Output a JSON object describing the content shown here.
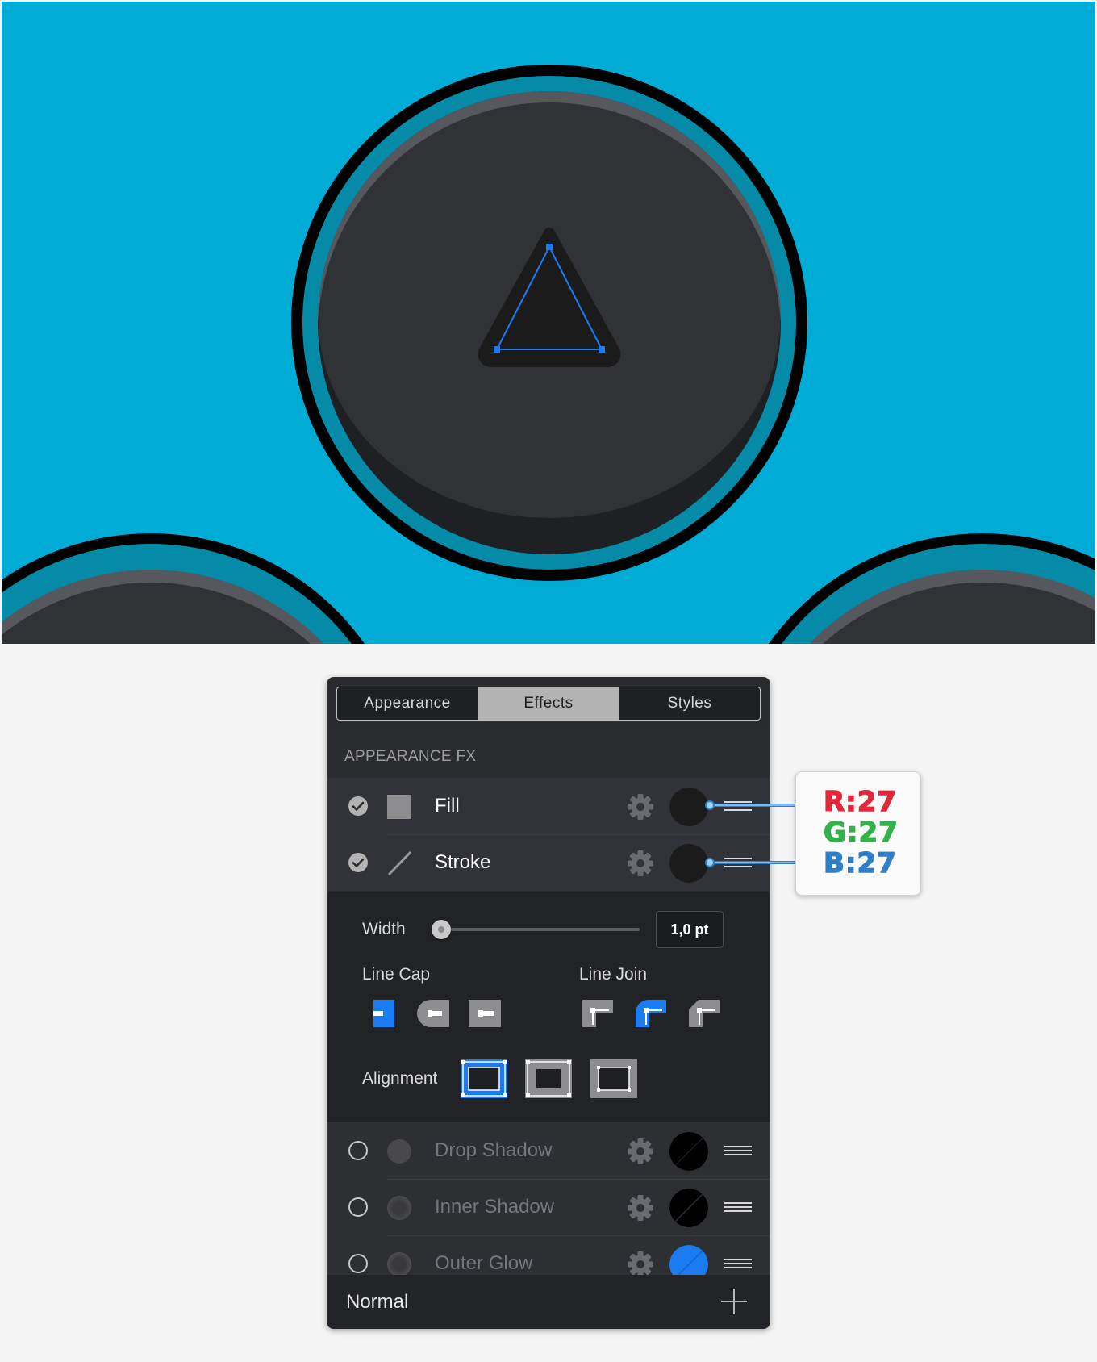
{
  "panel": {
    "tabs": [
      {
        "label": "Appearance"
      },
      {
        "label": "Effects"
      },
      {
        "label": "Styles"
      }
    ],
    "section_title": "APPEARANCE FX",
    "fx_rows": [
      {
        "label": "Fill",
        "enabled": true,
        "swatch_color": "#1b1b1b"
      },
      {
        "label": "Stroke",
        "enabled": true,
        "swatch_color": "#1b1b1b"
      },
      {
        "label": "Drop Shadow",
        "enabled": false,
        "swatch_color": "#000000"
      },
      {
        "label": "Inner Shadow",
        "enabled": false,
        "swatch_color": "#000000"
      },
      {
        "label": "Outer Glow",
        "enabled": false,
        "swatch_color": "#1a7cf0"
      }
    ],
    "stroke": {
      "width_label": "Width",
      "width_value": "1,0 pt",
      "line_cap_label": "Line Cap",
      "line_join_label": "Line Join",
      "alignment_label": "Alignment",
      "selected_cap": "butt",
      "selected_join": "round",
      "selected_alignment": "inside"
    },
    "blend_mode": "Normal"
  },
  "callout": {
    "r": "R:27",
    "g": "G:27",
    "b": "B:27"
  },
  "colors": {
    "canvas_bg": "#00acd6",
    "accent": "#1a7cf0",
    "callout_r": "#e0283a",
    "callout_g": "#35b04a",
    "callout_b": "#2f7fc8"
  }
}
